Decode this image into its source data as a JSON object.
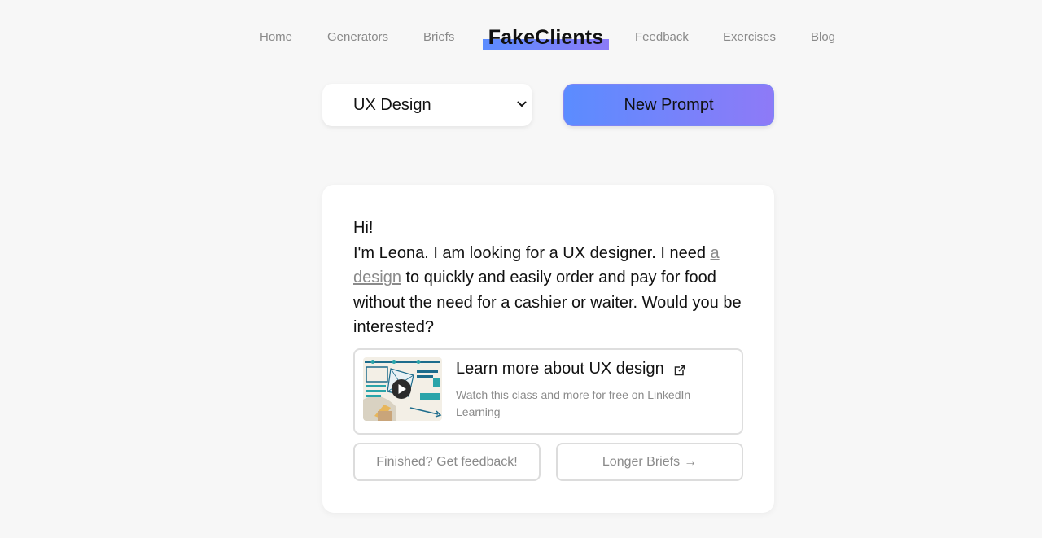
{
  "nav": {
    "home": "Home",
    "generators": "Generators",
    "briefs": "Briefs",
    "brand": "FakeClients",
    "feedback": "Feedback",
    "exercises": "Exercises",
    "blog": "Blog"
  },
  "controls": {
    "category_selected": "UX Design",
    "new_prompt_label": "New Prompt"
  },
  "brief": {
    "greeting": "Hi!",
    "text_before_link": "I'm Leona. I am looking for a UX designer. I need ",
    "link_text": "a design",
    "text_after_link": " to quickly and easily order and pay for food without the need for a cashier or waiter. Would you be interested?"
  },
  "promo": {
    "title": "Learn more about UX design",
    "description": "Watch this class and more for free on LinkedIn Learning",
    "icon": "external-link-icon"
  },
  "actions": {
    "feedback_label": "Finished? Get feedback!",
    "longer_label": "Longer Briefs",
    "longer_arrow": "→"
  },
  "colors": {
    "accent_start": "#5b8cff",
    "accent_end": "#8e7af7",
    "background": "#f7f7f7",
    "muted_text": "#8a8a8a"
  }
}
